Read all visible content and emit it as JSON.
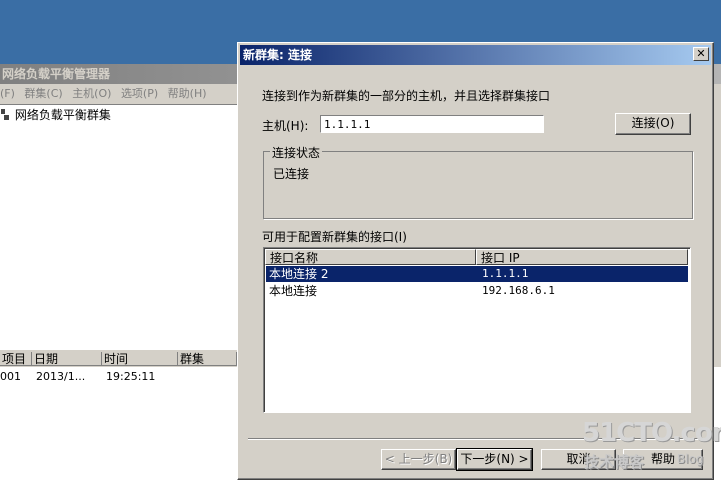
{
  "background_window": {
    "title": "网络负载平衡管理器",
    "menu": [
      "(F)",
      "群集(C)",
      "主机(O)",
      "选项(P)",
      "帮助(H)"
    ],
    "tree_item": "网络负载平衡群集",
    "log_columns": [
      "项目",
      "日期",
      "时间",
      "群集"
    ],
    "log_row": {
      "item": "001",
      "date": "2013/1...",
      "time": "19:25:11",
      "cluster": ""
    }
  },
  "dialog": {
    "title": "新群集: 连接",
    "instruction": "连接到作为新群集的一部分的主机，并且选择群集接口",
    "host_label": "主机(H):",
    "host_value": "1.1.1.1",
    "connect_button": "连接(O)",
    "status_group_title": "连接状态",
    "status_value": "已连接",
    "interfaces_label": "可用于配置新群集的接口(I)",
    "columns": [
      "接口名称",
      "接口 IP"
    ],
    "rows": [
      {
        "name": "本地连接 2",
        "ip": "1.1.1.1",
        "selected": true
      },
      {
        "name": "本地连接",
        "ip": "192.168.6.1",
        "selected": false
      }
    ],
    "buttons": {
      "back": "< 上一步(B)",
      "next": "下一步(N) >",
      "cancel": "取消",
      "help": "帮助"
    }
  },
  "watermark": {
    "main": "51CTO.com",
    "sub": "技术博客",
    "blog": "Blog"
  },
  "colors": {
    "desktop": "#3a6ea5",
    "title_active": "#0a246a",
    "selection": "#0a246a",
    "face": "#d4d0c8"
  }
}
